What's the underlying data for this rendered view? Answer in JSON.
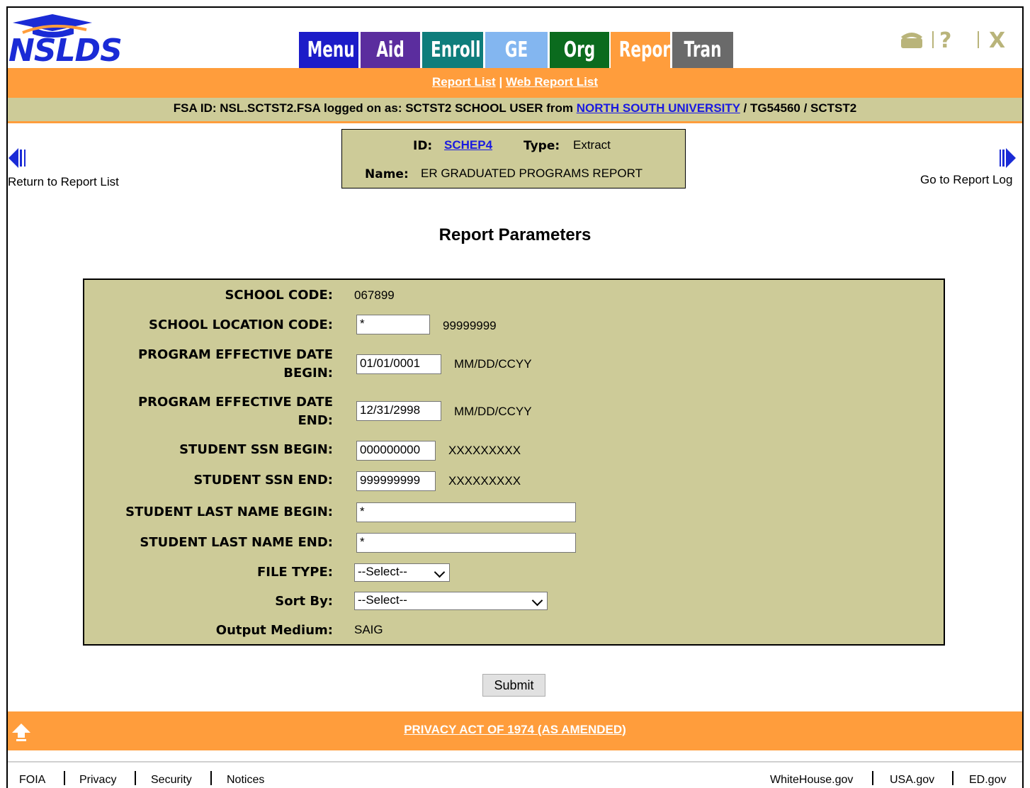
{
  "logo": {
    "text": "NSLDS"
  },
  "nav": {
    "tabs": [
      {
        "label": "Menu",
        "color": "#1c1cc8"
      },
      {
        "label": "Aid",
        "color": "#5b2d9e"
      },
      {
        "label": "Enroll",
        "color": "#0e7d7b"
      },
      {
        "label": "GE",
        "color": "#83b6f0"
      },
      {
        "label": "Org",
        "color": "#0b6b1e"
      },
      {
        "label": "Report",
        "color": "#ff9d3c"
      },
      {
        "label": "Tran",
        "color": "#6a6a6a"
      }
    ],
    "util_icons": [
      "phone-icon",
      "help-icon",
      "close-icon"
    ]
  },
  "report_links": {
    "report_list": "Report List",
    "separator": "|",
    "web_report_list": "Web Report List"
  },
  "status": {
    "prefix": "FSA ID: NSL.SCTST2.FSA logged on as: SCTST2 SCHOOL USER from",
    "school_link": "NORTH SOUTH UNIVERSITY",
    "suffix": "/ TG54560 / SCTST2"
  },
  "report_info": {
    "id_label": "ID:",
    "id_value": "SCHEP4",
    "type_label": "Type:",
    "type_value": "Extract",
    "name_label": "Name:",
    "name_value": "ER GRADUATED PROGRAMS REPORT"
  },
  "side_nav": {
    "back": "Return to Report List",
    "forward": "Go to Report Log"
  },
  "page_title": "Report Parameters",
  "params": {
    "school_code_label": "SCHOOL CODE:",
    "school_code_value": "067899",
    "location_label": "SCHOOL LOCATION CODE:",
    "location_value": "*",
    "location_hint": "99999999",
    "date_begin_label_1": "PROGRAM EFFECTIVE DATE",
    "date_begin_label_2": "BEGIN:",
    "date_begin_value": "01/01/0001",
    "date_begin_hint": "MM/DD/CCYY",
    "date_end_label_1": "PROGRAM EFFECTIVE DATE",
    "date_end_label_2": "END:",
    "date_end_value": "12/31/2998",
    "date_end_hint": "MM/DD/CCYY",
    "ssn_begin_label": "STUDENT SSN BEGIN:",
    "ssn_begin_value": "000000000",
    "ssn_begin_hint": "XXXXXXXXX",
    "ssn_end_label": "STUDENT SSN END:",
    "ssn_end_value": "999999999",
    "ssn_end_hint": "XXXXXXXXX",
    "last_begin_label": "STUDENT LAST NAME BEGIN:",
    "last_begin_value": "*",
    "last_end_label": "STUDENT LAST NAME END:",
    "last_end_value": "*",
    "file_type_label": "FILE TYPE:",
    "file_type_value": "--Select--",
    "sort_by_label": "Sort By:",
    "sort_by_value": "--Select--",
    "output_label": "Output Medium:",
    "output_value": "SAIG"
  },
  "submit_label": "Submit",
  "footer": {
    "privacy": "PRIVACY ACT OF 1974 (AS AMENDED)",
    "left_links": [
      "FOIA",
      "Privacy",
      "Security",
      "Notices"
    ],
    "right_links": [
      "WhiteHouse.gov",
      "USA.gov",
      "ED.gov"
    ]
  },
  "colors": {
    "accent_orange": "#ff9d3c",
    "panel_tan": "#cdcb98",
    "link_blue": "#1a1ae0"
  }
}
